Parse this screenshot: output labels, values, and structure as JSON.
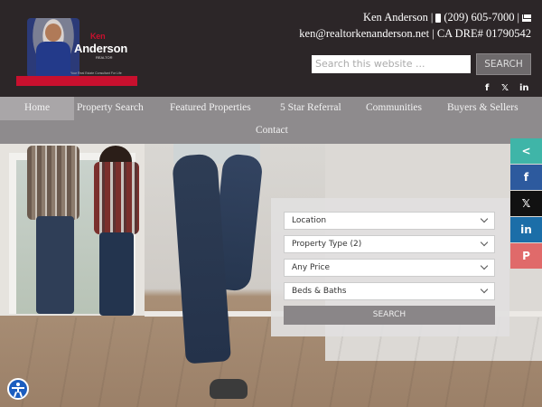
{
  "logo": {
    "first_name": "Ken",
    "last_name": "Anderson",
    "title": "REALTOR",
    "tagline": "Your Real Estate Consultant For Life"
  },
  "contact": {
    "name": "Ken Anderson",
    "separator1": "|",
    "phone": "(209) 605-7000",
    "separator2": "|",
    "email": "ken@realtorkenanderson.net",
    "separator3": "|",
    "license": "CA DRE# 01790542"
  },
  "search": {
    "placeholder": "Search this website ...",
    "button_label": "SEARCH"
  },
  "social_icons": [
    "facebook-icon",
    "x-icon",
    "linkedin-icon"
  ],
  "social": {
    "facebook": "f",
    "x": "𝕏",
    "linkedin": "in"
  },
  "nav": {
    "items": [
      "Home",
      "Property Search",
      "Featured Properties",
      "5 Star Referral",
      "Communities",
      "Buyers & Sellers",
      "Contact"
    ],
    "active": "Home"
  },
  "property_search": {
    "location": "Location",
    "property_type": "Property Type (2)",
    "price": "Any Price",
    "beds_baths": "Beds & Baths",
    "button_label": "SEARCH"
  },
  "share_bar": {
    "share": "<",
    "facebook": "f",
    "x": "𝕏",
    "linkedin": "in",
    "pinterest": "P"
  },
  "colors": {
    "header_bg": "#2c2628",
    "nav_bg": "#8e8b8d",
    "brand_red": "#c8102e",
    "share_teal": "#3fb5a8",
    "facebook_blue": "#2d5a9e",
    "x_black": "#111111",
    "linkedin_blue": "#1b6ea8",
    "pinterest_red": "#e06a6a",
    "accessibility_blue": "#1b5dbf"
  }
}
